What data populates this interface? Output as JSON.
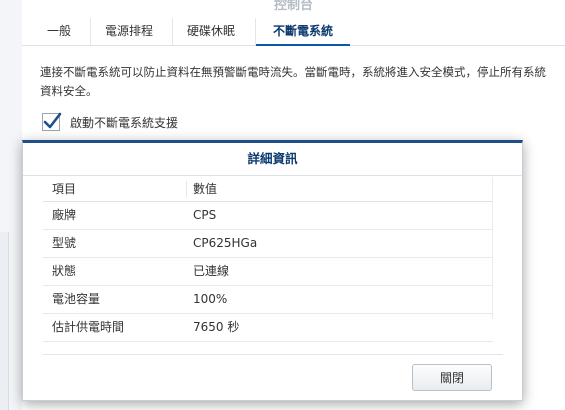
{
  "window": {
    "title": "控制台"
  },
  "tabs": [
    {
      "label": "一般"
    },
    {
      "label": "電源排程"
    },
    {
      "label": "硬碟休眠"
    },
    {
      "label": "不斷電系統",
      "active": true
    }
  ],
  "description": {
    "line1": "連接不斷電系統可以防止資料在無預警斷電時流失。當斷電時，系統將進入安全模式，停止所有系統",
    "line2": "資料安全。"
  },
  "ups_enable": {
    "label": "啟動不斷電系統支援",
    "checked": true
  },
  "modal": {
    "title": "詳細資訊",
    "columns": {
      "item": "項目",
      "value": "數值"
    },
    "rows": [
      {
        "item": "廠牌",
        "value": "CPS"
      },
      {
        "item": "型號",
        "value": "CP625HGa"
      },
      {
        "item": "狀態",
        "value": "已連線"
      },
      {
        "item": "電池容量",
        "value": "100%"
      },
      {
        "item": "估計供電時間",
        "value": "7650 秒"
      }
    ],
    "close_label": "關閉"
  },
  "colors": {
    "accent": "#1f4f86",
    "tab_active": "#0b3a6f",
    "check": "#1d4f8a"
  }
}
